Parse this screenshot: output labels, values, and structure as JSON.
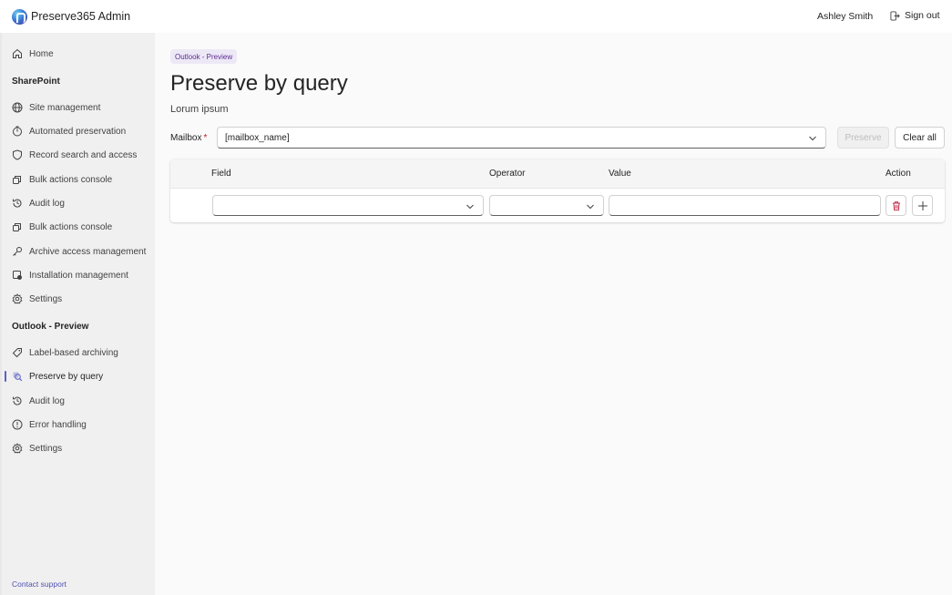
{
  "header": {
    "app_title": "Preserve365 Admin",
    "user_name": "Ashley Smith",
    "signout_label": "Sign out"
  },
  "sidebar": {
    "home": "Home",
    "sharepoint_heading": "SharePoint",
    "sharepoint_items": [
      {
        "label": "Site management",
        "icon": "globe-icon"
      },
      {
        "label": "Automated preservation",
        "icon": "timer-icon"
      },
      {
        "label": "Record search and access",
        "icon": "shield-icon"
      },
      {
        "label": "Bulk actions console",
        "icon": "bulk-actions-icon"
      },
      {
        "label": "Audit log",
        "icon": "history-icon"
      },
      {
        "label": "Bulk actions console",
        "icon": "bulk-actions-icon"
      },
      {
        "label": "Archive access management",
        "icon": "key-icon"
      },
      {
        "label": "Installation management",
        "icon": "installation-icon"
      },
      {
        "label": "Settings",
        "icon": "gear-icon"
      }
    ],
    "outlook_heading": "Outlook - Preview",
    "outlook_items": [
      {
        "label": "Label-based archiving",
        "icon": "tag-icon"
      },
      {
        "label": "Preserve by query",
        "icon": "query-icon",
        "active": true
      },
      {
        "label": "Audit log",
        "icon": "history-icon"
      },
      {
        "label": "Error handling",
        "icon": "error-icon"
      },
      {
        "label": "Settings",
        "icon": "gear-icon"
      }
    ],
    "contact_support": "Contact support"
  },
  "main": {
    "badge": "Outlook - Preview",
    "title": "Preserve by query",
    "subtitle": "Lorum ipsum",
    "mailbox_label": "Mailbox",
    "mailbox_required_marker": "*",
    "mailbox_value": "[mailbox_name]",
    "preserve_label": "Preserve",
    "clear_all_label": "Clear all",
    "grid": {
      "headers": {
        "field": "Field",
        "operator": "Operator",
        "value": "Value",
        "action": "Action"
      },
      "row": {
        "field": "",
        "operator": "",
        "value": ""
      }
    }
  },
  "colors": {
    "accent": "#5b5fc7",
    "badge_bg": "#ede8f6",
    "badge_text": "#5c2e91",
    "delete_red": "#c4314b",
    "required_red": "#c50f1f"
  }
}
